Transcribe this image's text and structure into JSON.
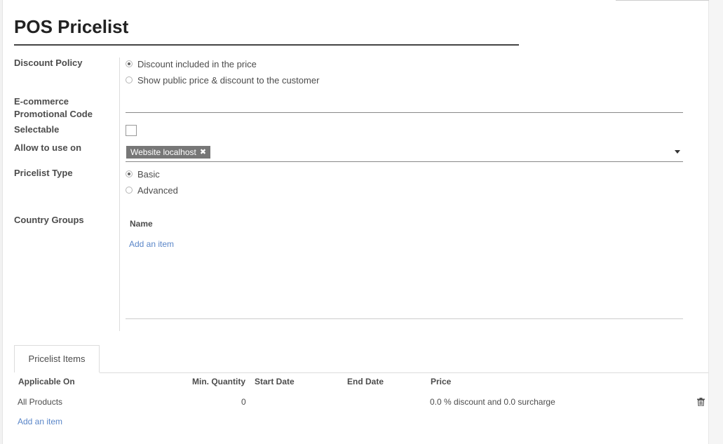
{
  "title": "POS Pricelist",
  "fields": {
    "discount_policy": {
      "label": "Discount Policy",
      "options": [
        "Discount included in the price",
        "Show public price & discount to the customer"
      ],
      "selected": 0
    },
    "promo_code": {
      "label_line1": "E-commerce",
      "label_line2": "Promotional Code",
      "value": ""
    },
    "selectable": {
      "label": "Selectable",
      "checked": false
    },
    "allow_to_use_on": {
      "label": "Allow to use on",
      "tags": [
        "Website localhost"
      ]
    },
    "pricelist_type": {
      "label": "Pricelist Type",
      "options": [
        "Basic",
        "Advanced"
      ],
      "selected": 0
    },
    "country_groups": {
      "label": "Country Groups",
      "column": "Name",
      "add_item": "Add an item"
    }
  },
  "tabs": [
    {
      "label": "Pricelist Items",
      "active": true
    }
  ],
  "items_table": {
    "columns": [
      "Applicable On",
      "Min. Quantity",
      "Start Date",
      "End Date",
      "Price"
    ],
    "rows": [
      {
        "applicable_on": "All Products",
        "min_quantity": "0",
        "start_date": "",
        "end_date": "",
        "price": "0.0 % discount and 0.0 surcharge"
      }
    ],
    "add_item": "Add an item"
  },
  "colors": {
    "link": "#5a86c8",
    "tag_bg": "#777777",
    "heading": "#222222"
  }
}
